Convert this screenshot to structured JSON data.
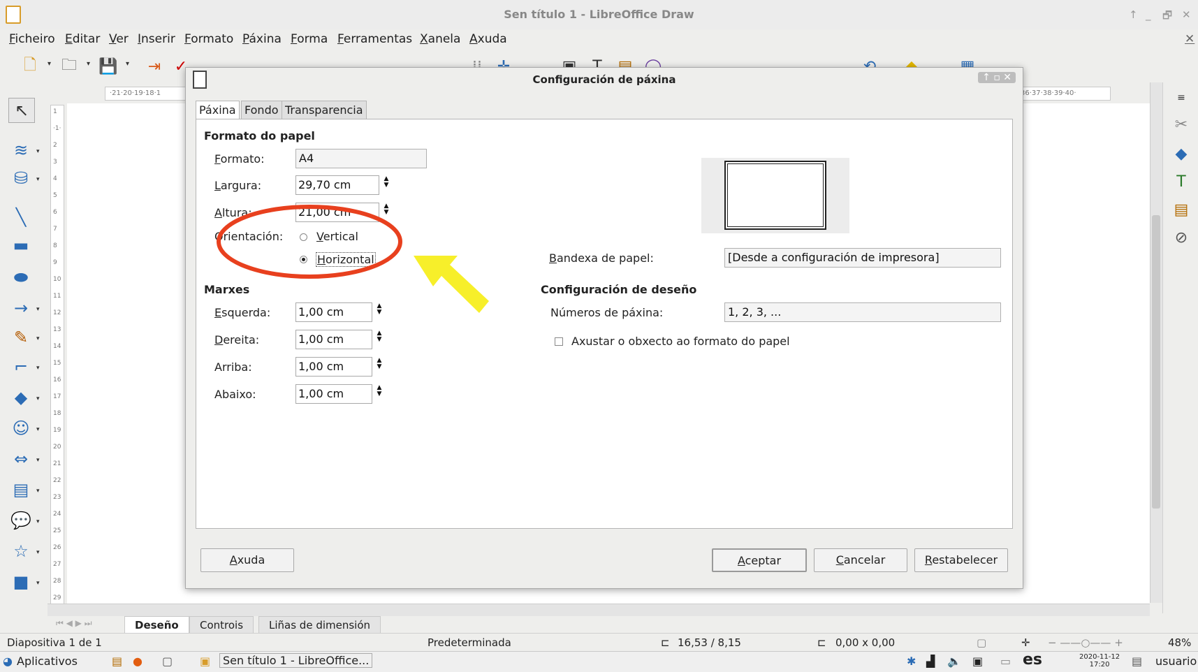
{
  "window": {
    "title": "Sen título 1 - LibreOffice Draw",
    "controls": [
      "↑",
      "_",
      "🗗",
      "✕"
    ]
  },
  "menubar": {
    "items": [
      "Ficheiro",
      "Editar",
      "Ver",
      "Inserir",
      "Formato",
      "Páxina",
      "Forma",
      "Ferramentas",
      "Xanela",
      "Axuda"
    ]
  },
  "rulers": {
    "h_left": "·21·20·19·18·1",
    "h_right": "36·37·38·39·40·",
    "v_ticks": [
      "1",
      "·1·",
      "2",
      "3",
      "4",
      "5",
      "6",
      "7",
      "8",
      "9",
      "10",
      "11",
      "12",
      "13",
      "14",
      "15",
      "16",
      "17",
      "18",
      "19",
      "20",
      "21",
      "22",
      "23",
      "24",
      "25",
      "26",
      "27",
      "28",
      "29"
    ]
  },
  "dialog": {
    "title": "Configuración de páxina",
    "tabs": [
      "Páxina",
      "Fondo",
      "Transparencia"
    ],
    "paper_format": {
      "heading": "Formato do papel",
      "format_label": "Formato:",
      "format_value": "A4",
      "width_label": "Largura:",
      "width_value": "29,70 cm",
      "height_label": "Altura:",
      "height_value": "21,00 cm",
      "orientation_label": "Orientación:",
      "orientation_options": [
        "Vertical",
        "Horizontal"
      ],
      "orientation_selected": "Horizontal"
    },
    "margins": {
      "heading": "Marxes",
      "left_label": "Esquerda:",
      "left_value": "1,00 cm",
      "right_label": "Dereita:",
      "right_value": "1,00 cm",
      "top_label": "Arriba:",
      "top_value": "1,00 cm",
      "bottom_label": "Abaixo:",
      "bottom_value": "1,00 cm"
    },
    "paper_tray_label": "Bandexa de papel:",
    "paper_tray_value": "[Desde a configuración de impresora]",
    "layout": {
      "heading": "Configuración de deseño",
      "page_numbers_label": "Números de páxina:",
      "page_numbers_value": "1, 2, 3, ...",
      "fit_object_label": "Axustar o obxecto ao formato do papel",
      "fit_object_checked": false
    },
    "buttons": {
      "help": "Axuda",
      "ok": "Aceptar",
      "cancel": "Cancelar",
      "reset": "Restabelecer"
    }
  },
  "annotation_colors": {
    "ellipse": "#e8401e",
    "arrow": "#f7ef2a"
  },
  "sheet_tabs": [
    "Deseño",
    "Controis",
    "Liñas de dimensión"
  ],
  "statusbar": {
    "slide": "Diapositiva 1 de 1",
    "master": "Predeterminada",
    "position": "16,53 / 8,15",
    "size": "0,00 x 0,00",
    "zoom": "48%"
  },
  "taskbar": {
    "apps_label": "Aplicativos",
    "window_label": "Sen título 1 - LibreOffice...",
    "lang": "es",
    "date": "2020-11-12",
    "time": "17:20",
    "user": "usuario"
  }
}
